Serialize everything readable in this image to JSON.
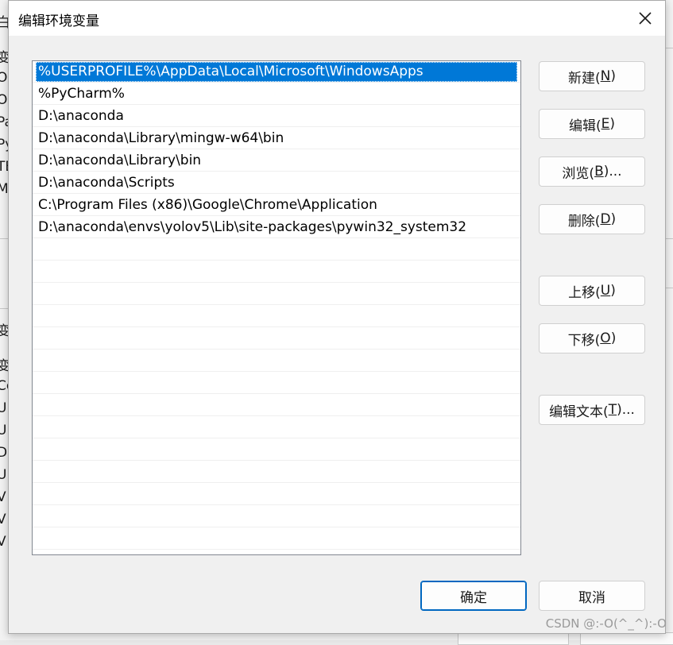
{
  "dialog": {
    "title": "编辑环境变量",
    "close_label": "×"
  },
  "path_list": {
    "selected_index": 0,
    "items": [
      "%USERPROFILE%\\AppData\\Local\\Microsoft\\WindowsApps",
      "%PyCharm%",
      "D:\\anaconda",
      "D:\\anaconda\\Library\\mingw-w64\\bin",
      "D:\\anaconda\\Library\\bin",
      "D:\\anaconda\\Scripts",
      "C:\\Program Files (x86)\\Google\\Chrome\\Application",
      "D:\\anaconda\\envs\\yolov5\\Lib\\site-packages\\pywin32_system32",
      "",
      "",
      "",
      "",
      "",
      "",
      "",
      "",
      "",
      "",
      "",
      "",
      "",
      "",
      ""
    ]
  },
  "buttons": {
    "new": {
      "pre": "新建(",
      "key": "N",
      "post": ")"
    },
    "edit": {
      "pre": "编辑(",
      "key": "E",
      "post": ")"
    },
    "browse": {
      "pre": "浏览(",
      "key": "B",
      "post": ")..."
    },
    "delete": {
      "pre": "删除(",
      "key": "D",
      "post": ")"
    },
    "move_up": {
      "pre": "上移(",
      "key": "U",
      "post": ")"
    },
    "move_down": {
      "pre": "下移(",
      "key": "O",
      "post": ")"
    },
    "edit_text": {
      "pre": "编辑文本(",
      "key": "T",
      "post": ")..."
    },
    "ok": "确定",
    "cancel": "取消"
  },
  "background_window": {
    "fragments": [
      "白",
      "变量",
      "On",
      "On",
      "Pat",
      "Py",
      "TE",
      "M",
      "变",
      "变量",
      "Co",
      "U",
      "U",
      "Dri",
      "U",
      "V",
      "V",
      "V"
    ]
  },
  "watermark": "CSDN @:-O(^_^):-O",
  "colors": {
    "selection": "#0078d7",
    "primary_border": "#0067c0"
  }
}
